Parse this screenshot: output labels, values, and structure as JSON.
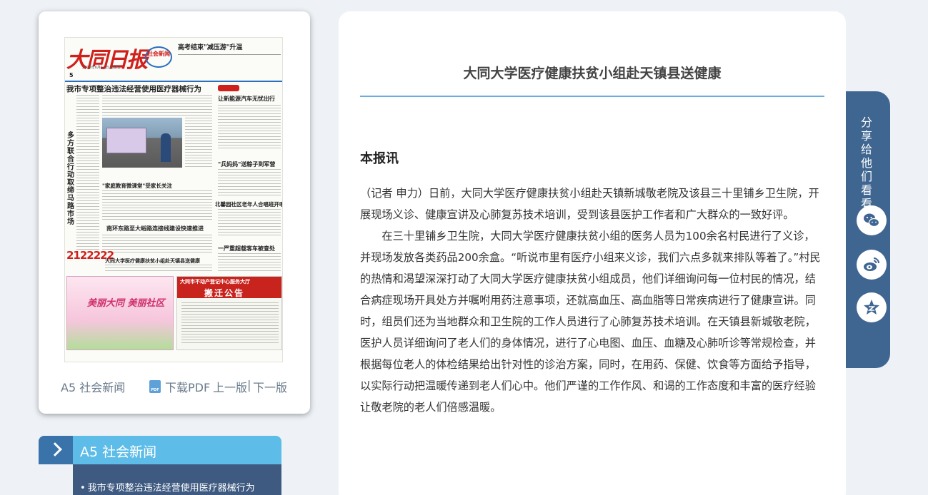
{
  "newspaper": {
    "masthead_title": "大同日报",
    "section_logo": "社会新闻",
    "top_headline": "高考结束\"减压游\"升温",
    "page_number": "5",
    "dateline": "2019年6月14日 星期五",
    "headlines": [
      "我市专项整治违法经营使用医疗器械行为",
      "让新能源汽车无忧出行",
      "\"兵妈妈\"送粽子到军营",
      "北馨园社区老年人合唱班开唱",
      "\"家庭教育微课堂\"受家长关注",
      "南环东路至大峪路连接线建设快速推进",
      "一严重超载客车被查处",
      "大同大学医疗健康扶贫小组赴天镇县送健康"
    ],
    "vertical_headline": "多方联合行动 取缔马路市场",
    "phone_ad": "2122222",
    "ad_left_title": "美丽大同 美丽社区",
    "ad_right_subtitle": "大同市不动产登记中心服务大厅",
    "ad_right_title": "搬迁公告"
  },
  "paper_footer": {
    "section": "A5 社会新闻",
    "download": "下载PDF",
    "prev": "上一版",
    "separator": "|",
    "next": "下一版"
  },
  "section_menu": {
    "title": "A5  社会新闻",
    "items": [
      "我市专项整治违法经营使用医疗器械行为"
    ]
  },
  "article": {
    "title": "大同大学医疗健康扶贫小组赴天镇县送健康",
    "byline": "本报讯",
    "paragraphs": [
      "（记者 申力）日前，大同大学医疗健康扶贫小组赴天镇新城敬老院及该县三十里铺乡卫生院，开展现场义诊、健康宣讲及心肺复苏技术培训，受到该县医护工作者和广大群众的一致好评。",
      "在三十里铺乡卫生院，大同大学医疗健康扶贫小组的医务人员为100余名村民进行了义诊，并现场发放各类药品200余盒。“听说市里有医疗小组来义诊，我们六点多就来排队等着了。”村民的热情和渴望深深打动了大同大学医疗健康扶贫小组成员，他们详细询问每一位村民的情况，结合病症现场开具处方并嘱咐用药注意事项，还就高血压、高血脂等日常疾病进行了健康宣讲。同时，组员们还为当地群众和卫生院的工作人员进行了心肺复苏技术培训。在天镇县新城敬老院，医护人员详细询问了老人们的身体情况，进行了心电图、血压、血糖及心肺听诊等常规检查，并根据每位老人的体检结果给出针对性的诊治方案，同时，在用药、保健、饮食等方面给予指导，以实际行动把温暖传递到老人们心中。他们严谨的工作作风、和谒的工作态度和丰富的医疗经验让敬老院的老人们倍感温暖。"
    ]
  },
  "share": {
    "label": "分享给他们看看",
    "buttons": [
      "wechat-icon",
      "weibo-icon",
      "qzone-icon"
    ]
  },
  "colors": {
    "accent": "#5dbde8",
    "dark_blue": "#3f6591",
    "masthead_red": "#d0201c"
  }
}
